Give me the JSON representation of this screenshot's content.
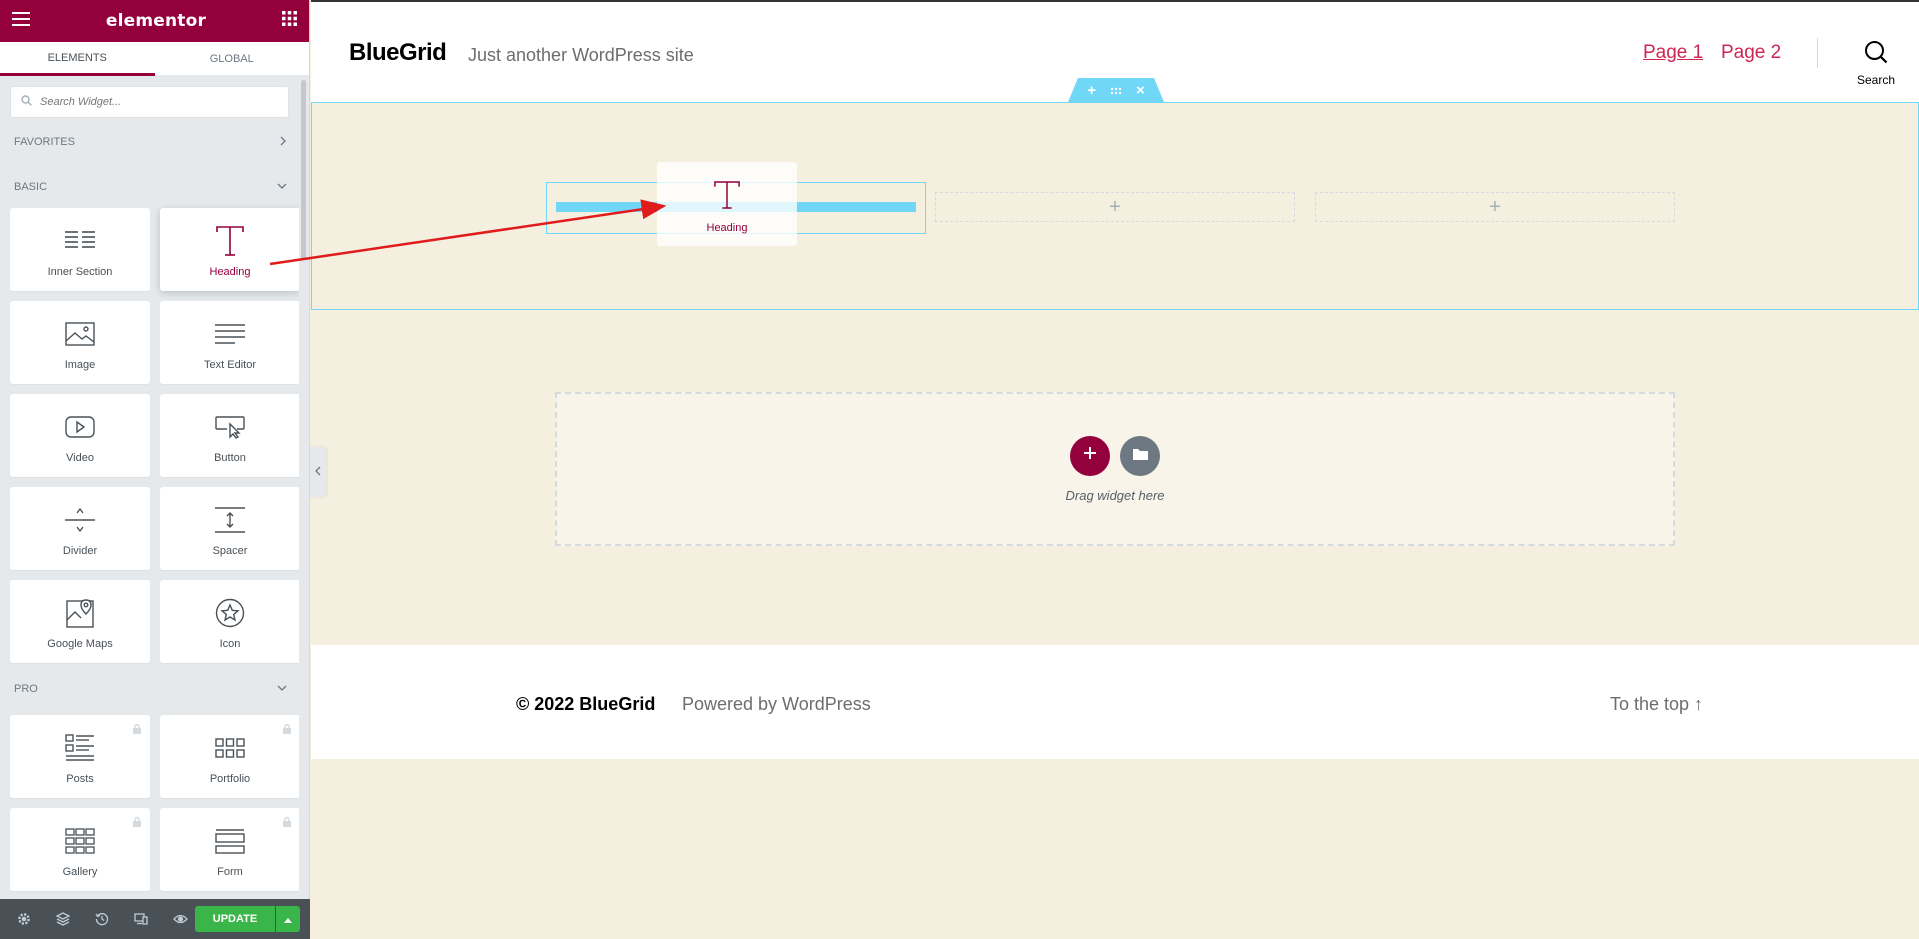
{
  "editor": {
    "brand": "elementor",
    "tabs": [
      {
        "label": "ELEMENTS",
        "active": true
      },
      {
        "label": "GLOBAL",
        "active": false
      }
    ],
    "search": {
      "placeholder": "Search Widget..."
    },
    "categories": {
      "favorites": "FAVORITES",
      "basic": "BASIC",
      "pro": "PRO"
    },
    "basic_widgets": [
      {
        "label": "Inner Section",
        "icon": "inner-section-icon"
      },
      {
        "label": "Heading",
        "icon": "heading-icon"
      },
      {
        "label": "Image",
        "icon": "image-icon"
      },
      {
        "label": "Text Editor",
        "icon": "text-editor-icon"
      },
      {
        "label": "Video",
        "icon": "video-icon"
      },
      {
        "label": "Button",
        "icon": "button-icon"
      },
      {
        "label": "Divider",
        "icon": "divider-icon"
      },
      {
        "label": "Spacer",
        "icon": "spacer-icon"
      },
      {
        "label": "Google Maps",
        "icon": "google-maps-icon"
      },
      {
        "label": "Icon",
        "icon": "star-icon"
      }
    ],
    "pro_widgets": [
      {
        "label": "Posts",
        "icon": "posts-icon",
        "locked": true
      },
      {
        "label": "Portfolio",
        "icon": "portfolio-icon",
        "locked": true
      },
      {
        "label": "Gallery",
        "icon": "gallery-icon",
        "locked": true
      },
      {
        "label": "Form",
        "icon": "form-icon",
        "locked": true
      }
    ],
    "footer": {
      "update_label": "UPDATE"
    },
    "accent": "#93003c",
    "update_color": "#39b54a"
  },
  "site": {
    "title": "BlueGrid",
    "description": "Just another WordPress site",
    "nav": [
      "Page 1",
      "Page 2"
    ],
    "search_label": "Search",
    "drag_ghost_label": "Heading",
    "empty_area_text": "Drag widget here",
    "footer": {
      "copyright": "© 2022 BlueGrid",
      "powered": "Powered by WordPress",
      "to_top": "To the top ↑"
    },
    "link_color": "#cd2653",
    "section_highlight": "#71d7f7"
  }
}
